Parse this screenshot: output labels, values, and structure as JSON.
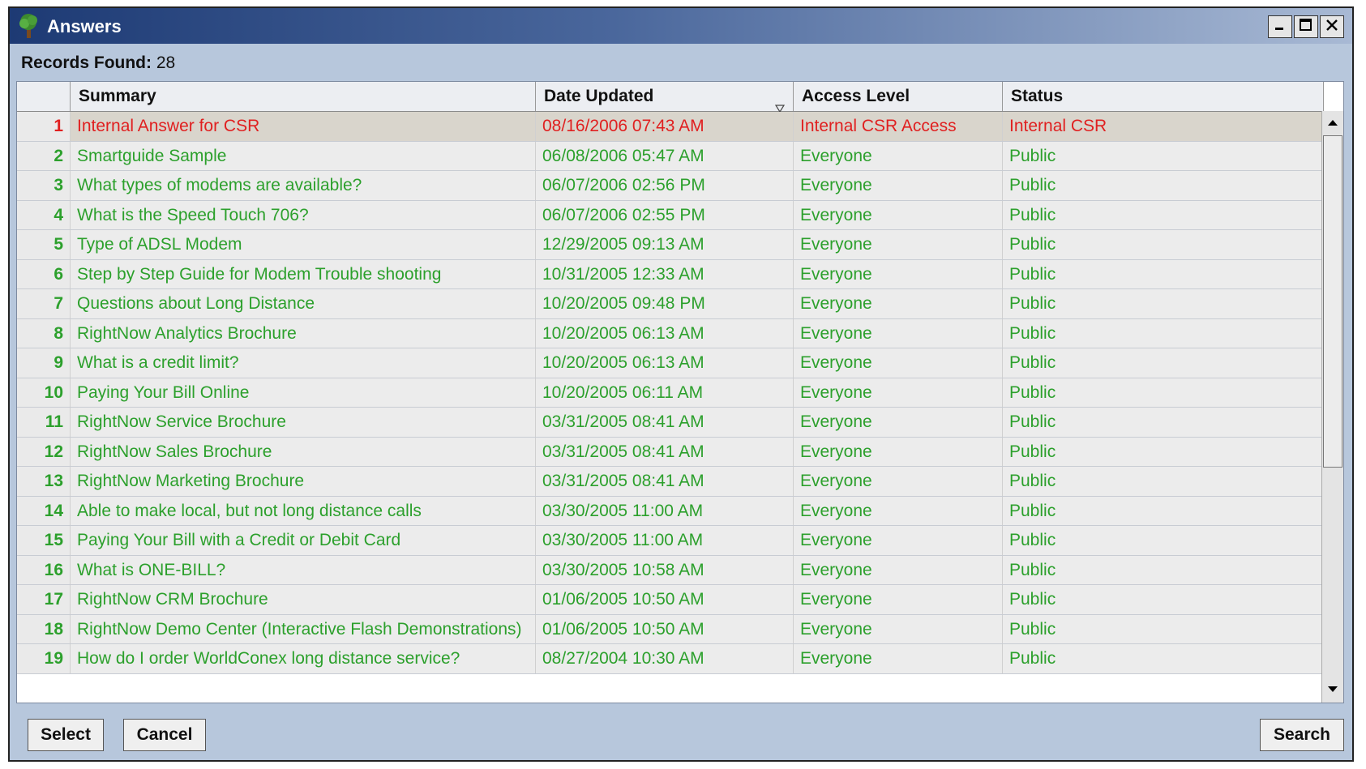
{
  "window": {
    "title": "Answers",
    "records_label": "Records Found:",
    "records_count": "28"
  },
  "columns": [
    "Summary",
    "Date Updated",
    "Access Level",
    "Status"
  ],
  "rows": [
    {
      "num": "1",
      "summary": "Internal Answer for CSR",
      "date": "08/16/2006 07:43 AM",
      "access": "Internal CSR Access",
      "status": "Internal CSR",
      "selected": true
    },
    {
      "num": "2",
      "summary": "Smartguide Sample",
      "date": "06/08/2006 05:47 AM",
      "access": "Everyone",
      "status": "Public"
    },
    {
      "num": "3",
      "summary": "What types of modems are available?",
      "date": "06/07/2006 02:56 PM",
      "access": "Everyone",
      "status": "Public"
    },
    {
      "num": "4",
      "summary": "What is the Speed Touch 706?",
      "date": "06/07/2006 02:55 PM",
      "access": "Everyone",
      "status": "Public"
    },
    {
      "num": "5",
      "summary": "Type of ADSL Modem",
      "date": "12/29/2005 09:13 AM",
      "access": "Everyone",
      "status": "Public"
    },
    {
      "num": "6",
      "summary": "Step by Step Guide for Modem Trouble shooting",
      "date": "10/31/2005 12:33 AM",
      "access": "Everyone",
      "status": "Public"
    },
    {
      "num": "7",
      "summary": "Questions about Long Distance",
      "date": "10/20/2005 09:48 PM",
      "access": "Everyone",
      "status": "Public"
    },
    {
      "num": "8",
      "summary": "RightNow Analytics Brochure",
      "date": "10/20/2005 06:13 AM",
      "access": "Everyone",
      "status": "Public"
    },
    {
      "num": "9",
      "summary": "What is a credit limit?",
      "date": "10/20/2005 06:13 AM",
      "access": "Everyone",
      "status": "Public"
    },
    {
      "num": "10",
      "summary": "Paying Your Bill Online",
      "date": "10/20/2005 06:11 AM",
      "access": "Everyone",
      "status": "Public"
    },
    {
      "num": "11",
      "summary": "RightNow Service Brochure",
      "date": "03/31/2005 08:41 AM",
      "access": "Everyone",
      "status": "Public"
    },
    {
      "num": "12",
      "summary": "RightNow Sales Brochure",
      "date": "03/31/2005 08:41 AM",
      "access": "Everyone",
      "status": "Public"
    },
    {
      "num": "13",
      "summary": "RightNow Marketing Brochure",
      "date": "03/31/2005 08:41 AM",
      "access": "Everyone",
      "status": "Public"
    },
    {
      "num": "14",
      "summary": "Able to make local, but not long distance calls",
      "date": "03/30/2005 11:00 AM",
      "access": "Everyone",
      "status": "Public"
    },
    {
      "num": "15",
      "summary": "Paying Your Bill with a Credit or Debit Card",
      "date": "03/30/2005 11:00 AM",
      "access": "Everyone",
      "status": "Public"
    },
    {
      "num": "16",
      "summary": "What is ONE-BILL?",
      "date": "03/30/2005 10:58 AM",
      "access": "Everyone",
      "status": "Public"
    },
    {
      "num": "17",
      "summary": "RightNow CRM Brochure",
      "date": "01/06/2005 10:50 AM",
      "access": "Everyone",
      "status": "Public"
    },
    {
      "num": "18",
      "summary": "RightNow Demo Center (Interactive Flash Demonstrations)",
      "date": "01/06/2005 10:50 AM",
      "access": "Everyone",
      "status": "Public"
    },
    {
      "num": "19",
      "summary": "How do I order WorldConex long distance service?",
      "date": "08/27/2004 10:30 AM",
      "access": "Everyone",
      "status": "Public"
    }
  ],
  "buttons": {
    "select": "Select",
    "cancel": "Cancel",
    "search": "Search"
  },
  "icons": {
    "app": "tree-icon",
    "minimize": "minimize-icon",
    "maximize": "maximize-icon",
    "close": "close-icon",
    "sort": "sort-desc-icon",
    "scroll_up": "arrow-up-icon",
    "scroll_down": "arrow-down-icon"
  },
  "colors": {
    "selected_text": "#e02020",
    "row_text": "#2ca02c",
    "selected_row_bg": "#d9d5cc"
  }
}
